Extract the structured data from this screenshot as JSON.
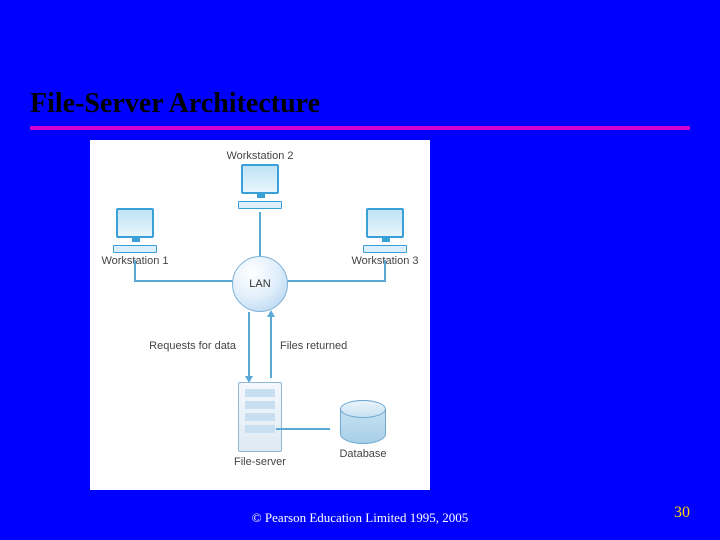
{
  "title": "File-Server Architecture",
  "diagram": {
    "workstations": [
      {
        "label": "Workstation 1"
      },
      {
        "label": "Workstation 2"
      },
      {
        "label": "Workstation 3"
      }
    ],
    "lan_label": "LAN",
    "flow_request_label": "Requests for data",
    "flow_return_label": "Files returned",
    "server_label": "File-server",
    "database_label": "Database"
  },
  "footer": {
    "copyright": "© Pearson Education Limited 1995, 2005"
  },
  "slide_number": "30"
}
